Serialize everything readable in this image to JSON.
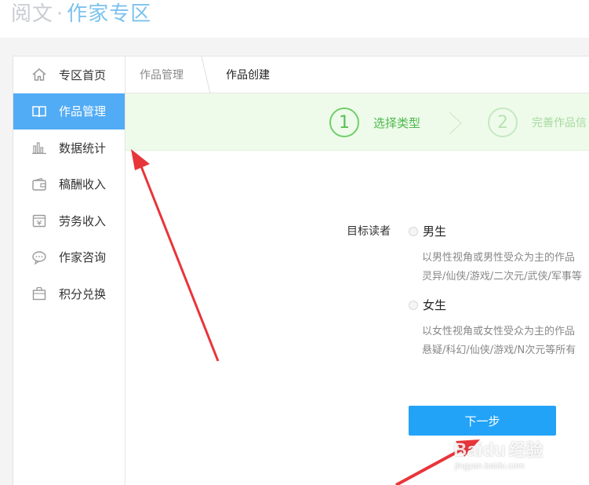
{
  "header": {
    "brand": "阅文",
    "separator": "·",
    "section": "作家专区"
  },
  "sidebar": {
    "items": [
      {
        "label": "专区首页",
        "icon": "home-icon"
      },
      {
        "label": "作品管理",
        "icon": "book-icon",
        "active": true
      },
      {
        "label": "数据统计",
        "icon": "bar-chart-icon"
      },
      {
        "label": "稿酬收入",
        "icon": "wallet-icon"
      },
      {
        "label": "劳务收入",
        "icon": "calendar-icon"
      },
      {
        "label": "作家咨询",
        "icon": "chat-icon"
      },
      {
        "label": "积分兑换",
        "icon": "bag-icon"
      }
    ]
  },
  "breadcrumb": {
    "parent": "作品管理",
    "current": "作品创建"
  },
  "steps": [
    {
      "number": "1",
      "label": "选择类型",
      "state": "active"
    },
    {
      "number": "2",
      "label": "完善作品信",
      "state": "inactive"
    }
  ],
  "form": {
    "target_label": "目标读者",
    "options": [
      {
        "label": "男生",
        "desc_line1": "以男性视角或男性受众为主的作品",
        "desc_line2": "灵异/仙侠/游戏/二次元/武侠/军事等"
      },
      {
        "label": "女生",
        "desc_line1": "以女性视角或女性受众为主的作品",
        "desc_line2": "悬疑/科幻/仙侠/游戏/N次元等所有"
      }
    ],
    "next_button": "下一步"
  },
  "watermark": {
    "text": "Baidu",
    "sub": "经验",
    "url": "jingyan.baidu.com"
  },
  "colors": {
    "accent": "#52acf5",
    "button": "#22a3f8",
    "step_green": "#5bbd58",
    "arrow_red": "#e8353a"
  }
}
